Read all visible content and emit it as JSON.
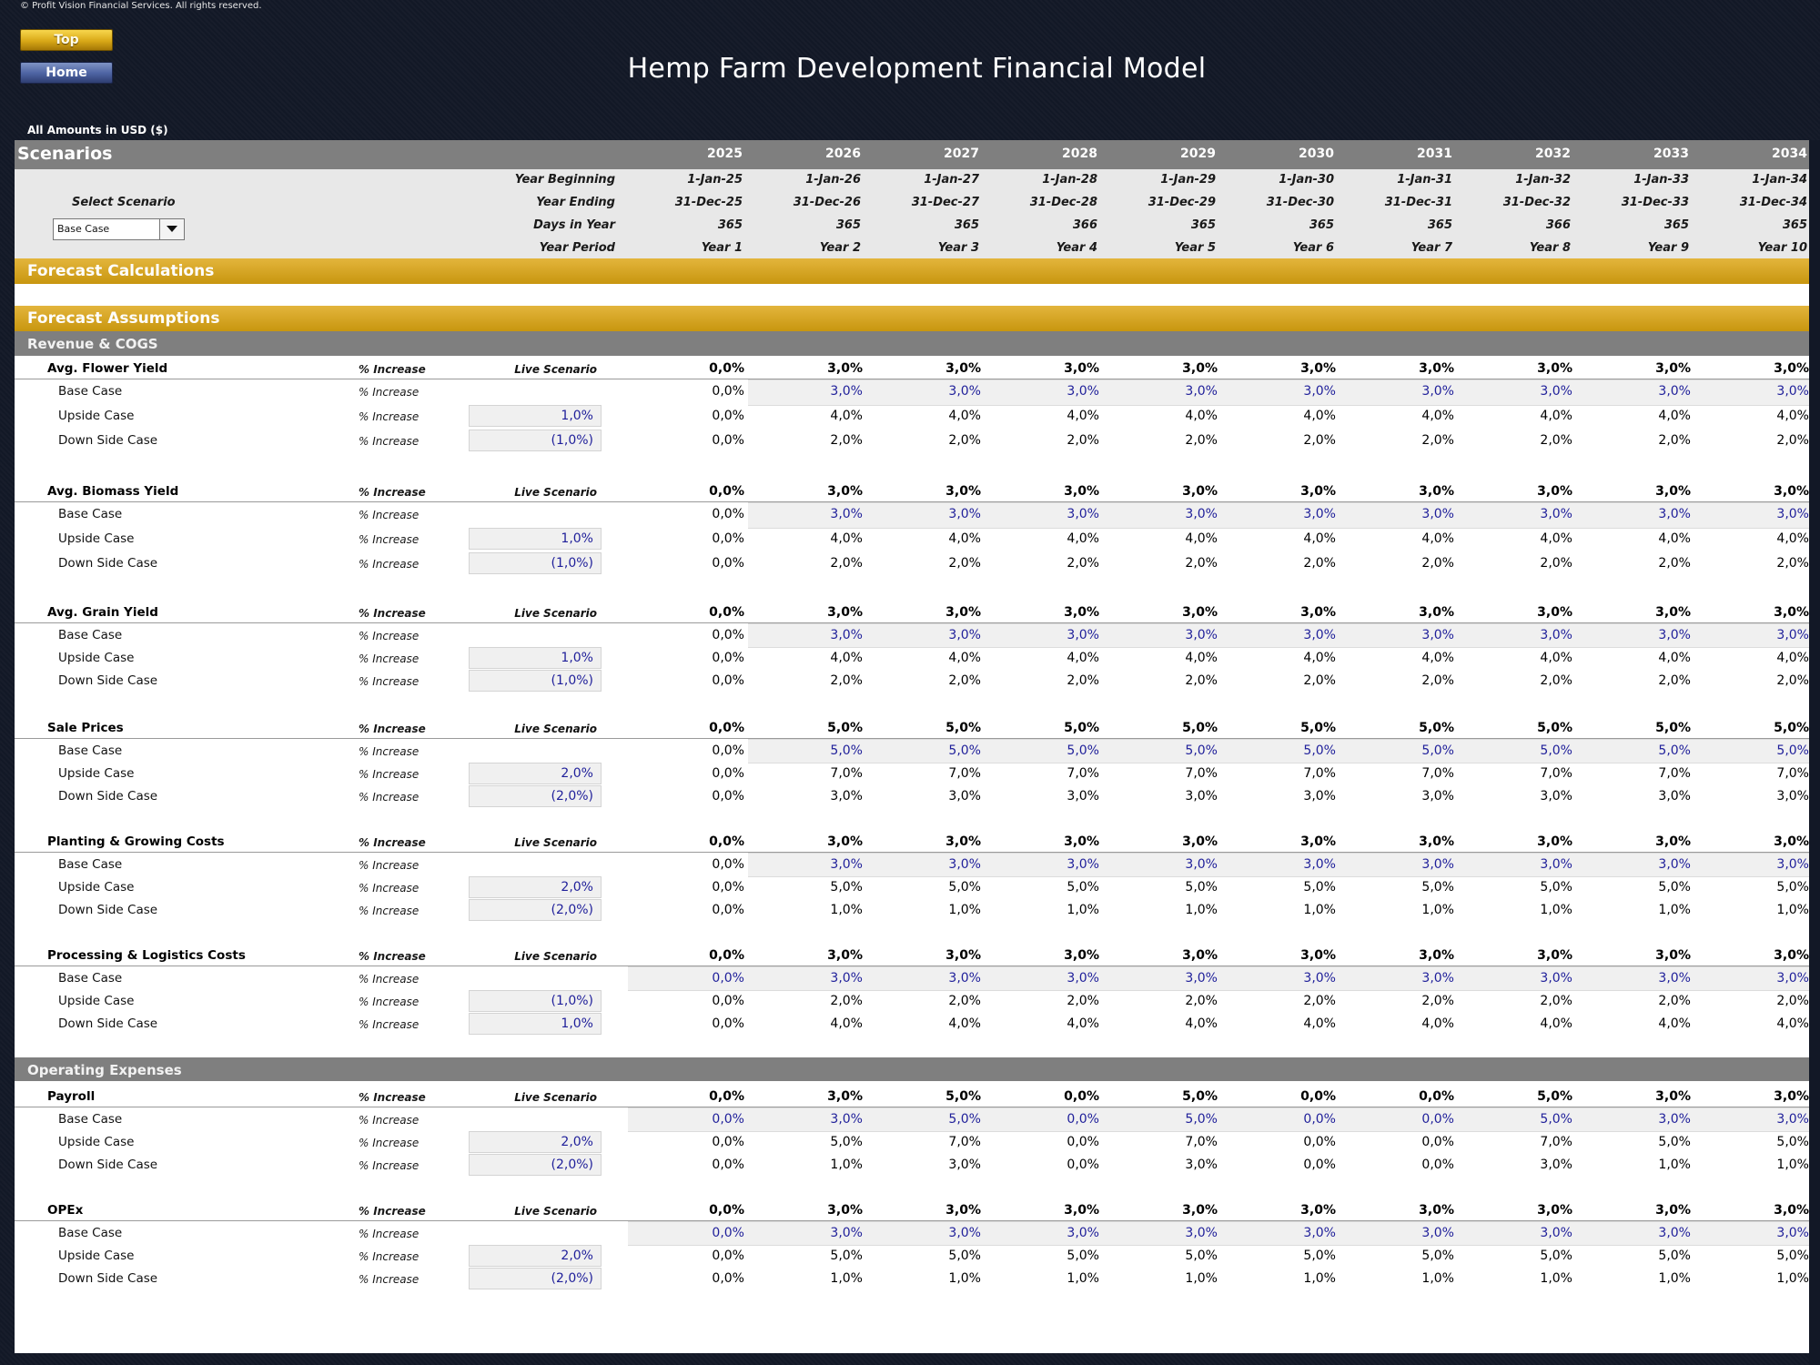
{
  "copyright": "© Profit Vision Financial Services. All rights reserved.",
  "nav": {
    "top_label": "Top",
    "home_label": "Home"
  },
  "title": "Hemp Farm Development Financial Model",
  "amounts_note": "All Amounts in  USD ($)",
  "scenarios": {
    "label": "Scenarios",
    "select_label": "Select Scenario",
    "selected": "Base Case",
    "years": [
      "2025",
      "2026",
      "2027",
      "2028",
      "2029",
      "2030",
      "2031",
      "2032",
      "2033",
      "2034"
    ],
    "row_labels": {
      "year_beginning": "Year Beginning",
      "year_ending": "Year Ending",
      "days_in_year": "Days in Year",
      "year_period": "Year Period"
    },
    "year_beginning": [
      "1-Jan-25",
      "1-Jan-26",
      "1-Jan-27",
      "1-Jan-28",
      "1-Jan-29",
      "1-Jan-30",
      "1-Jan-31",
      "1-Jan-32",
      "1-Jan-33",
      "1-Jan-34"
    ],
    "year_ending": [
      "31-Dec-25",
      "31-Dec-26",
      "31-Dec-27",
      "31-Dec-28",
      "31-Dec-29",
      "31-Dec-30",
      "31-Dec-31",
      "31-Dec-32",
      "31-Dec-33",
      "31-Dec-34"
    ],
    "days_in_year": [
      "365",
      "365",
      "365",
      "366",
      "365",
      "365",
      "365",
      "366",
      "365",
      "365"
    ],
    "year_period": [
      "Year 1",
      "Year 2",
      "Year 3",
      "Year 4",
      "Year 5",
      "Year 6",
      "Year 7",
      "Year 8",
      "Year 9",
      "Year 10"
    ]
  },
  "sections": {
    "forecast_calculations": "Forecast Calculations",
    "forecast_assumptions": "Forecast Assumptions",
    "revenue_cogs": "Revenue & COGS",
    "operating_expenses": "Operating Expenses"
  },
  "groups": [
    {
      "name": "Avg. Flower Yield",
      "unit": "% Increase",
      "live_label": "Live Scenario",
      "live": [
        "0,0%",
        "3,0%",
        "3,0%",
        "3,0%",
        "3,0%",
        "3,0%",
        "3,0%",
        "3,0%",
        "3,0%",
        "3,0%"
      ],
      "cases": [
        {
          "label": "Base Case",
          "unit": "% Increase",
          "input": "",
          "values": [
            "0,0%",
            "3,0%",
            "3,0%",
            "3,0%",
            "3,0%",
            "3,0%",
            "3,0%",
            "3,0%",
            "3,0%",
            "3,0%"
          ]
        },
        {
          "label": "Upside Case",
          "unit": "% Increase",
          "input": "1,0%",
          "values": [
            "0,0%",
            "4,0%",
            "4,0%",
            "4,0%",
            "4,0%",
            "4,0%",
            "4,0%",
            "4,0%",
            "4,0%",
            "4,0%"
          ]
        },
        {
          "label": "Down Side Case",
          "unit": "% Increase",
          "input": "(1,0%)",
          "values": [
            "0,0%",
            "2,0%",
            "2,0%",
            "2,0%",
            "2,0%",
            "2,0%",
            "2,0%",
            "2,0%",
            "2,0%",
            "2,0%"
          ]
        }
      ]
    },
    {
      "name": "Avg. Biomass Yield",
      "unit": "% Increase",
      "live_label": "Live Scenario",
      "live": [
        "0,0%",
        "3,0%",
        "3,0%",
        "3,0%",
        "3,0%",
        "3,0%",
        "3,0%",
        "3,0%",
        "3,0%",
        "3,0%"
      ],
      "cases": [
        {
          "label": "Base Case",
          "unit": "% Increase",
          "input": "",
          "values": [
            "0,0%",
            "3,0%",
            "3,0%",
            "3,0%",
            "3,0%",
            "3,0%",
            "3,0%",
            "3,0%",
            "3,0%",
            "3,0%"
          ]
        },
        {
          "label": "Upside Case",
          "unit": "% Increase",
          "input": "1,0%",
          "values": [
            "0,0%",
            "4,0%",
            "4,0%",
            "4,0%",
            "4,0%",
            "4,0%",
            "4,0%",
            "4,0%",
            "4,0%",
            "4,0%"
          ]
        },
        {
          "label": "Down Side Case",
          "unit": "% Increase",
          "input": "(1,0%)",
          "values": [
            "0,0%",
            "2,0%",
            "2,0%",
            "2,0%",
            "2,0%",
            "2,0%",
            "2,0%",
            "2,0%",
            "2,0%",
            "2,0%"
          ]
        }
      ]
    },
    {
      "name": "Avg. Grain Yield",
      "unit": "% Increase",
      "live_label": "Live Scenario",
      "live": [
        "0,0%",
        "3,0%",
        "3,0%",
        "3,0%",
        "3,0%",
        "3,0%",
        "3,0%",
        "3,0%",
        "3,0%",
        "3,0%"
      ],
      "cases": [
        {
          "label": "Base Case",
          "unit": "% Increase",
          "input": "",
          "values": [
            "0,0%",
            "3,0%",
            "3,0%",
            "3,0%",
            "3,0%",
            "3,0%",
            "3,0%",
            "3,0%",
            "3,0%",
            "3,0%"
          ]
        },
        {
          "label": "Upside Case",
          "unit": "% Increase",
          "input": "1,0%",
          "values": [
            "0,0%",
            "4,0%",
            "4,0%",
            "4,0%",
            "4,0%",
            "4,0%",
            "4,0%",
            "4,0%",
            "4,0%",
            "4,0%"
          ]
        },
        {
          "label": "Down Side Case",
          "unit": "% Increase",
          "input": "(1,0%)",
          "values": [
            "0,0%",
            "2,0%",
            "2,0%",
            "2,0%",
            "2,0%",
            "2,0%",
            "2,0%",
            "2,0%",
            "2,0%",
            "2,0%"
          ]
        }
      ]
    },
    {
      "name": "Sale Prices",
      "unit": "% Increase",
      "live_label": "Live Scenario",
      "live": [
        "0,0%",
        "5,0%",
        "5,0%",
        "5,0%",
        "5,0%",
        "5,0%",
        "5,0%",
        "5,0%",
        "5,0%",
        "5,0%"
      ],
      "cases": [
        {
          "label": "Base Case",
          "unit": "% Increase",
          "input": "",
          "values": [
            "0,0%",
            "5,0%",
            "5,0%",
            "5,0%",
            "5,0%",
            "5,0%",
            "5,0%",
            "5,0%",
            "5,0%",
            "5,0%"
          ]
        },
        {
          "label": "Upside Case",
          "unit": "% Increase",
          "input": "2,0%",
          "values": [
            "0,0%",
            "7,0%",
            "7,0%",
            "7,0%",
            "7,0%",
            "7,0%",
            "7,0%",
            "7,0%",
            "7,0%",
            "7,0%"
          ]
        },
        {
          "label": "Down Side Case",
          "unit": "% Increase",
          "input": "(2,0%)",
          "values": [
            "0,0%",
            "3,0%",
            "3,0%",
            "3,0%",
            "3,0%",
            "3,0%",
            "3,0%",
            "3,0%",
            "3,0%",
            "3,0%"
          ]
        }
      ]
    },
    {
      "name": "Planting & Growing Costs",
      "unit": "% Increase",
      "live_label": "Live Scenario",
      "live": [
        "0,0%",
        "3,0%",
        "3,0%",
        "3,0%",
        "3,0%",
        "3,0%",
        "3,0%",
        "3,0%",
        "3,0%",
        "3,0%"
      ],
      "cases": [
        {
          "label": "Base Case",
          "unit": "% Increase",
          "input": "",
          "values": [
            "0,0%",
            "3,0%",
            "3,0%",
            "3,0%",
            "3,0%",
            "3,0%",
            "3,0%",
            "3,0%",
            "3,0%",
            "3,0%"
          ]
        },
        {
          "label": "Upside Case",
          "unit": "% Increase",
          "input": "2,0%",
          "values": [
            "0,0%",
            "5,0%",
            "5,0%",
            "5,0%",
            "5,0%",
            "5,0%",
            "5,0%",
            "5,0%",
            "5,0%",
            "5,0%"
          ]
        },
        {
          "label": "Down Side Case",
          "unit": "% Increase",
          "input": "(2,0%)",
          "values": [
            "0,0%",
            "1,0%",
            "1,0%",
            "1,0%",
            "1,0%",
            "1,0%",
            "1,0%",
            "1,0%",
            "1,0%",
            "1,0%"
          ]
        }
      ]
    },
    {
      "name": "Processing & Logistics Costs",
      "unit": "% Increase",
      "live_label": "Live Scenario",
      "live": [
        "0,0%",
        "3,0%",
        "3,0%",
        "3,0%",
        "3,0%",
        "3,0%",
        "3,0%",
        "3,0%",
        "3,0%",
        "3,0%"
      ],
      "cases": [
        {
          "label": "Base Case",
          "unit": "% Increase",
          "input": "",
          "values": [
            "0,0%",
            "3,0%",
            "3,0%",
            "3,0%",
            "3,0%",
            "3,0%",
            "3,0%",
            "3,0%",
            "3,0%",
            "3,0%"
          ]
        },
        {
          "label": "Upside Case",
          "unit": "% Increase",
          "input": "(1,0%)",
          "values": [
            "0,0%",
            "2,0%",
            "2,0%",
            "2,0%",
            "2,0%",
            "2,0%",
            "2,0%",
            "2,0%",
            "2,0%",
            "2,0%"
          ]
        },
        {
          "label": "Down Side Case",
          "unit": "% Increase",
          "input": "1,0%",
          "values": [
            "0,0%",
            "4,0%",
            "4,0%",
            "4,0%",
            "4,0%",
            "4,0%",
            "4,0%",
            "4,0%",
            "4,0%",
            "4,0%"
          ]
        }
      ]
    },
    {
      "name": "Payroll",
      "unit": "% Increase",
      "live_label": "Live Scenario",
      "live": [
        "0,0%",
        "3,0%",
        "5,0%",
        "0,0%",
        "5,0%",
        "0,0%",
        "0,0%",
        "5,0%",
        "3,0%",
        "3,0%"
      ],
      "cases": [
        {
          "label": "Base Case",
          "unit": "% Increase",
          "input": "",
          "values": [
            "0,0%",
            "3,0%",
            "5,0%",
            "0,0%",
            "5,0%",
            "0,0%",
            "0,0%",
            "5,0%",
            "3,0%",
            "3,0%"
          ]
        },
        {
          "label": "Upside Case",
          "unit": "% Increase",
          "input": "2,0%",
          "values": [
            "0,0%",
            "5,0%",
            "7,0%",
            "0,0%",
            "7,0%",
            "0,0%",
            "0,0%",
            "7,0%",
            "5,0%",
            "5,0%"
          ]
        },
        {
          "label": "Down Side Case",
          "unit": "% Increase",
          "input": "(2,0%)",
          "values": [
            "0,0%",
            "1,0%",
            "3,0%",
            "0,0%",
            "3,0%",
            "0,0%",
            "0,0%",
            "3,0%",
            "1,0%",
            "1,0%"
          ]
        }
      ]
    },
    {
      "name": "OPEx",
      "unit": "% Increase",
      "live_label": "Live Scenario",
      "live": [
        "0,0%",
        "3,0%",
        "3,0%",
        "3,0%",
        "3,0%",
        "3,0%",
        "3,0%",
        "3,0%",
        "3,0%",
        "3,0%"
      ],
      "cases": [
        {
          "label": "Base Case",
          "unit": "% Increase",
          "input": "",
          "values": [
            "0,0%",
            "3,0%",
            "3,0%",
            "3,0%",
            "3,0%",
            "3,0%",
            "3,0%",
            "3,0%",
            "3,0%",
            "3,0%"
          ]
        },
        {
          "label": "Upside Case",
          "unit": "% Increase",
          "input": "2,0%",
          "values": [
            "0,0%",
            "5,0%",
            "5,0%",
            "5,0%",
            "5,0%",
            "5,0%",
            "5,0%",
            "5,0%",
            "5,0%",
            "5,0%"
          ]
        },
        {
          "label": "Down Side Case",
          "unit": "% Increase",
          "input": "(2,0%)",
          "values": [
            "0,0%",
            "1,0%",
            "1,0%",
            "1,0%",
            "1,0%",
            "1,0%",
            "1,0%",
            "1,0%",
            "1,0%",
            "1,0%"
          ]
        }
      ]
    }
  ]
}
